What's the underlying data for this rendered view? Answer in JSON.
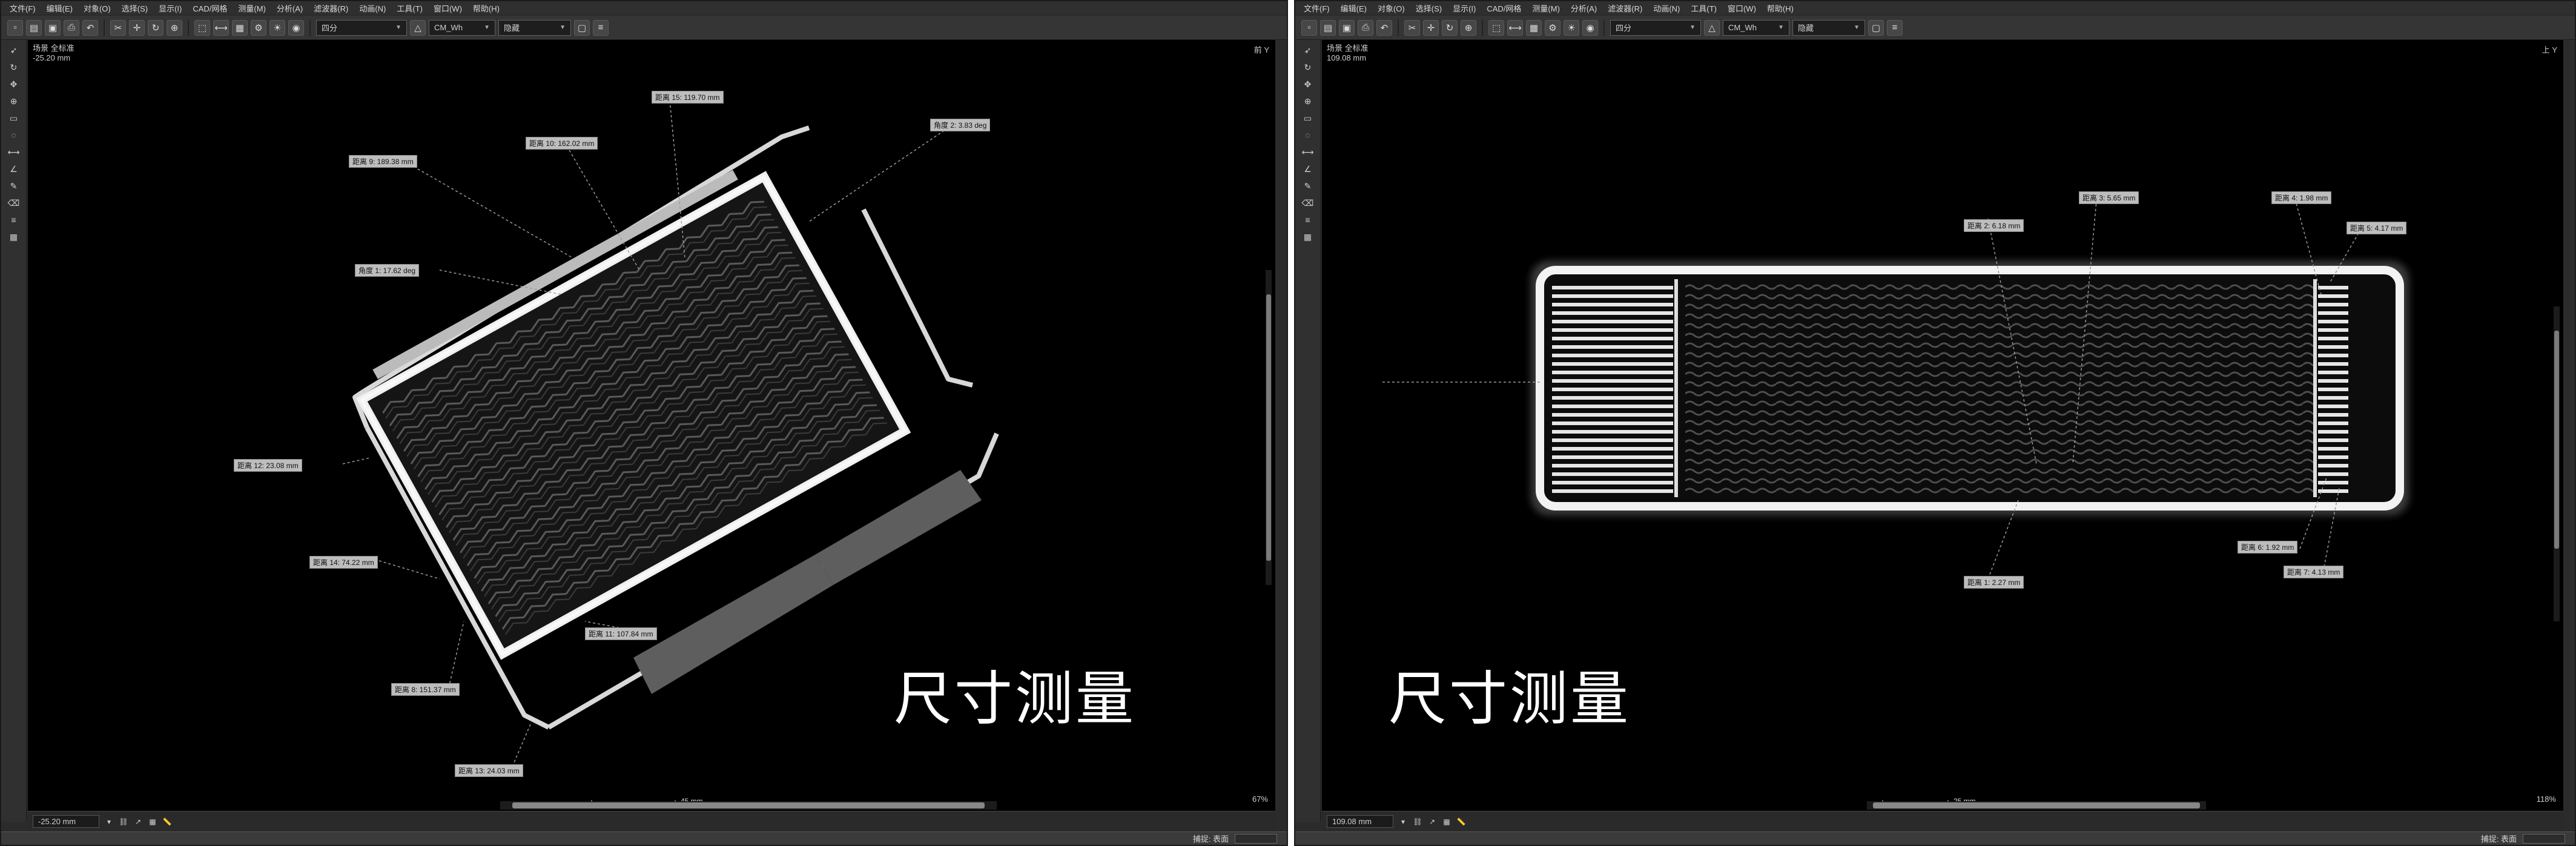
{
  "menu": [
    "文件(F)",
    "编辑(E)",
    "对象(O)",
    "选择(S)",
    "显示(I)",
    "CAD/网格",
    "测量(M)",
    "分析(A)",
    "滤波器(R)",
    "动画(N)",
    "工具(T)",
    "窗口(W)",
    "帮助(H)"
  ],
  "toolbar": {
    "render_mode": "四分",
    "color_map": "CM_Wh",
    "filter": "隐藏"
  },
  "status": {
    "label": "捕捉: 表面"
  },
  "left_pane": {
    "scene_label": "场景 全标准",
    "position": "-25.20 mm",
    "corner": "前 Y",
    "bottom_value": "-25.20 mm",
    "scale_label": "45 mm",
    "zoom": "67%",
    "overlay_title": "尺寸测量",
    "measurements": [
      "距离 15: 119.70 mm",
      "角度 2: 3.83 deg",
      "距离 10: 162.02 mm",
      "距离 9: 189.38 mm",
      "角度 1: 17.62 deg",
      "距离 12: 23.08 mm",
      "距离 14: 74.22 mm",
      "距离 11: 107.84 mm",
      "距离 8: 151.37 mm",
      "距离 13: 24.03 mm"
    ]
  },
  "right_pane": {
    "scene_label": "场景 全标准",
    "position": "109.08 mm",
    "corner": "上 Y",
    "bottom_value": "109.08 mm",
    "scale_label": "25 mm",
    "zoom": "118%",
    "overlay_title": "尺寸测量",
    "measurements": [
      "距离 2: 6.18 mm",
      "距离 3: 5.65 mm",
      "距离 4: 1.98 mm",
      "距离 5: 4.17 mm",
      "距离 6: 1.92 mm",
      "距离 7: 4.13 mm",
      "距离 1: 2.27 mm"
    ]
  },
  "icons": {
    "toolbar": [
      "new-icon",
      "open-icon",
      "save-icon",
      "print-icon",
      "undo-icon",
      "cut-icon",
      "copy-icon",
      "paste-icon",
      "select-icon",
      "move-icon",
      "rotate-icon",
      "zoom-icon",
      "measure-icon",
      "settings-icon"
    ],
    "tools": [
      "pointer-icon",
      "rotate-icon",
      "pan-icon",
      "zoom-icon",
      "box-icon",
      "lasso-icon",
      "measure-icon",
      "angle-icon",
      "brush-icon",
      "eraser-icon",
      "layers-icon",
      "grid-icon"
    ]
  },
  "colors": {
    "viewport_bg": "#000000",
    "chrome_bg": "#2b2b2b",
    "label_bg": "#bdbdbd"
  }
}
